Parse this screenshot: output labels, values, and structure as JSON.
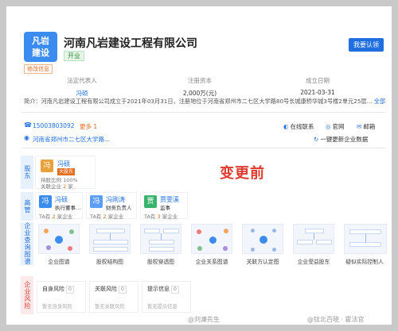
{
  "header": {
    "logo_line1": "凡岩",
    "logo_line2": "建设",
    "company_name": "河南凡岩建设工程有限公司",
    "status": "开业",
    "edit_tag": "修改信息",
    "verify_button": "我要认领"
  },
  "info": {
    "legal_rep_label": "法定代表人",
    "legal_rep_value": "冯硕",
    "capital_label": "注册资本",
    "capital_value": "2,000万(元)",
    "founded_label": "成立日期",
    "founded_value": "2021-03-31"
  },
  "description": {
    "text": "简介：河南凡岩建设工程有限公司成立于2021年03月31日，注册地位于河南省郑州市二七区大学路80号长城康桥华城3号楼2单元25层...",
    "more": "全部"
  },
  "contact": {
    "phone": "15003803092",
    "more": "更多 1",
    "address": "河南省郑州市二七区大学路...",
    "online": "在线联系",
    "website": "官网",
    "email": "邮箱",
    "new_data": "一键更新企业数据"
  },
  "change_label": "变更前",
  "shareholders": {
    "side": "股东",
    "name": "冯硕",
    "tag": "大股东",
    "ratio": "持股比例 100%",
    "linked_prefix": "关联企业",
    "linked_count": "2",
    "linked_suffix": "家"
  },
  "executives": {
    "side": "高管",
    "people": [
      {
        "avatar": "冯",
        "name": "冯硕",
        "role": "执行董事…",
        "prefix": "TA有",
        "count": "2",
        "suffix": "家企业",
        "color": "#3b8cf0"
      },
      {
        "avatar": "冯",
        "name": "冯刚涛",
        "role": "财务负责人",
        "prefix": "TA有",
        "count": "2",
        "suffix": "家企业",
        "color": "#5c9ef5"
      },
      {
        "avatar": "贾",
        "name": "贾雯溪",
        "role": "监事",
        "prefix": "TA有",
        "count": "3",
        "suffix": "家企业",
        "color": "#39b36b"
      }
    ]
  },
  "graphs": {
    "side": "企业查询图谱",
    "items": [
      "企业图谱",
      "股权结构图",
      "股权穿透图",
      "企业关系图谱",
      "关联方认定图",
      "企业受益股东",
      "疑似实际控制人"
    ]
  },
  "risk": {
    "side": "企业风险",
    "cards": [
      {
        "title": "自身风险",
        "count": "0",
        "sub": "暂无自身风险"
      },
      {
        "title": "关联风险",
        "count": "0",
        "sub": "暂无关联风险"
      },
      {
        "title": "提示信息",
        "count": "0",
        "sub": "暂无提示信息"
      }
    ]
  },
  "watermarks": {
    "left": "@刘濂先生",
    "right": "@钛北百晓 · 霍法官"
  },
  "colors": {
    "primary": "#1f6fe0",
    "accent_orange": "#e46c1f",
    "change_red": "#e03a2f"
  }
}
